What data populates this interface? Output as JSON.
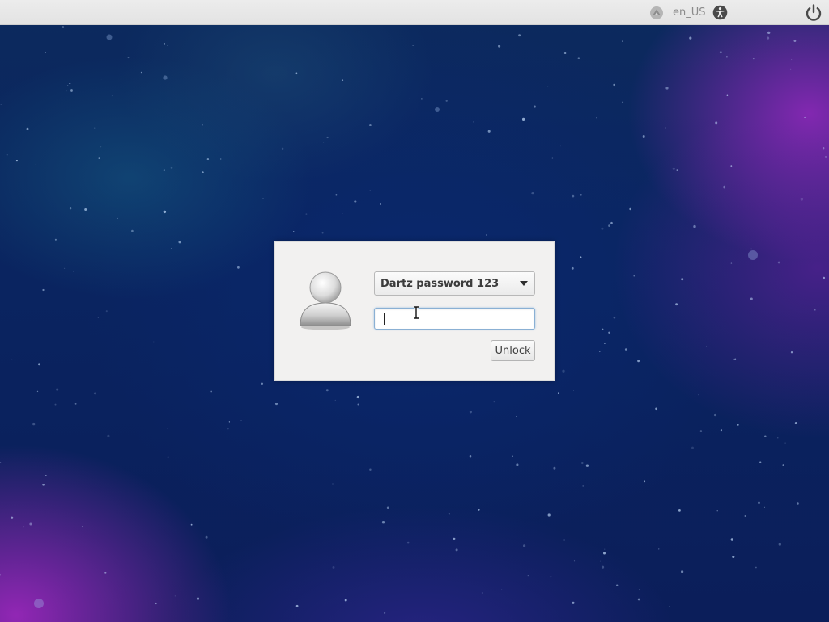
{
  "top_panel": {
    "network_icon": "network-disconnected-icon",
    "keyboard_layout": "en_US",
    "accessibility_icon": "accessibility-icon",
    "session_icon": "power-icon"
  },
  "lock_dialog": {
    "avatar_icon": "user-avatar-icon",
    "user_select": {
      "selected": "Dartz password 123",
      "arrow_icon": "dropdown-arrow-icon"
    },
    "password_field": {
      "value": "",
      "placeholder": ""
    },
    "unlock_label": "Unlock"
  },
  "colors": {
    "panel_bg": "#e8e8e8",
    "dialog_bg": "#f2f1f0",
    "focus_border": "#8ab0d4",
    "background_deep_blue": "#0a2460",
    "background_purple": "#9628be"
  }
}
